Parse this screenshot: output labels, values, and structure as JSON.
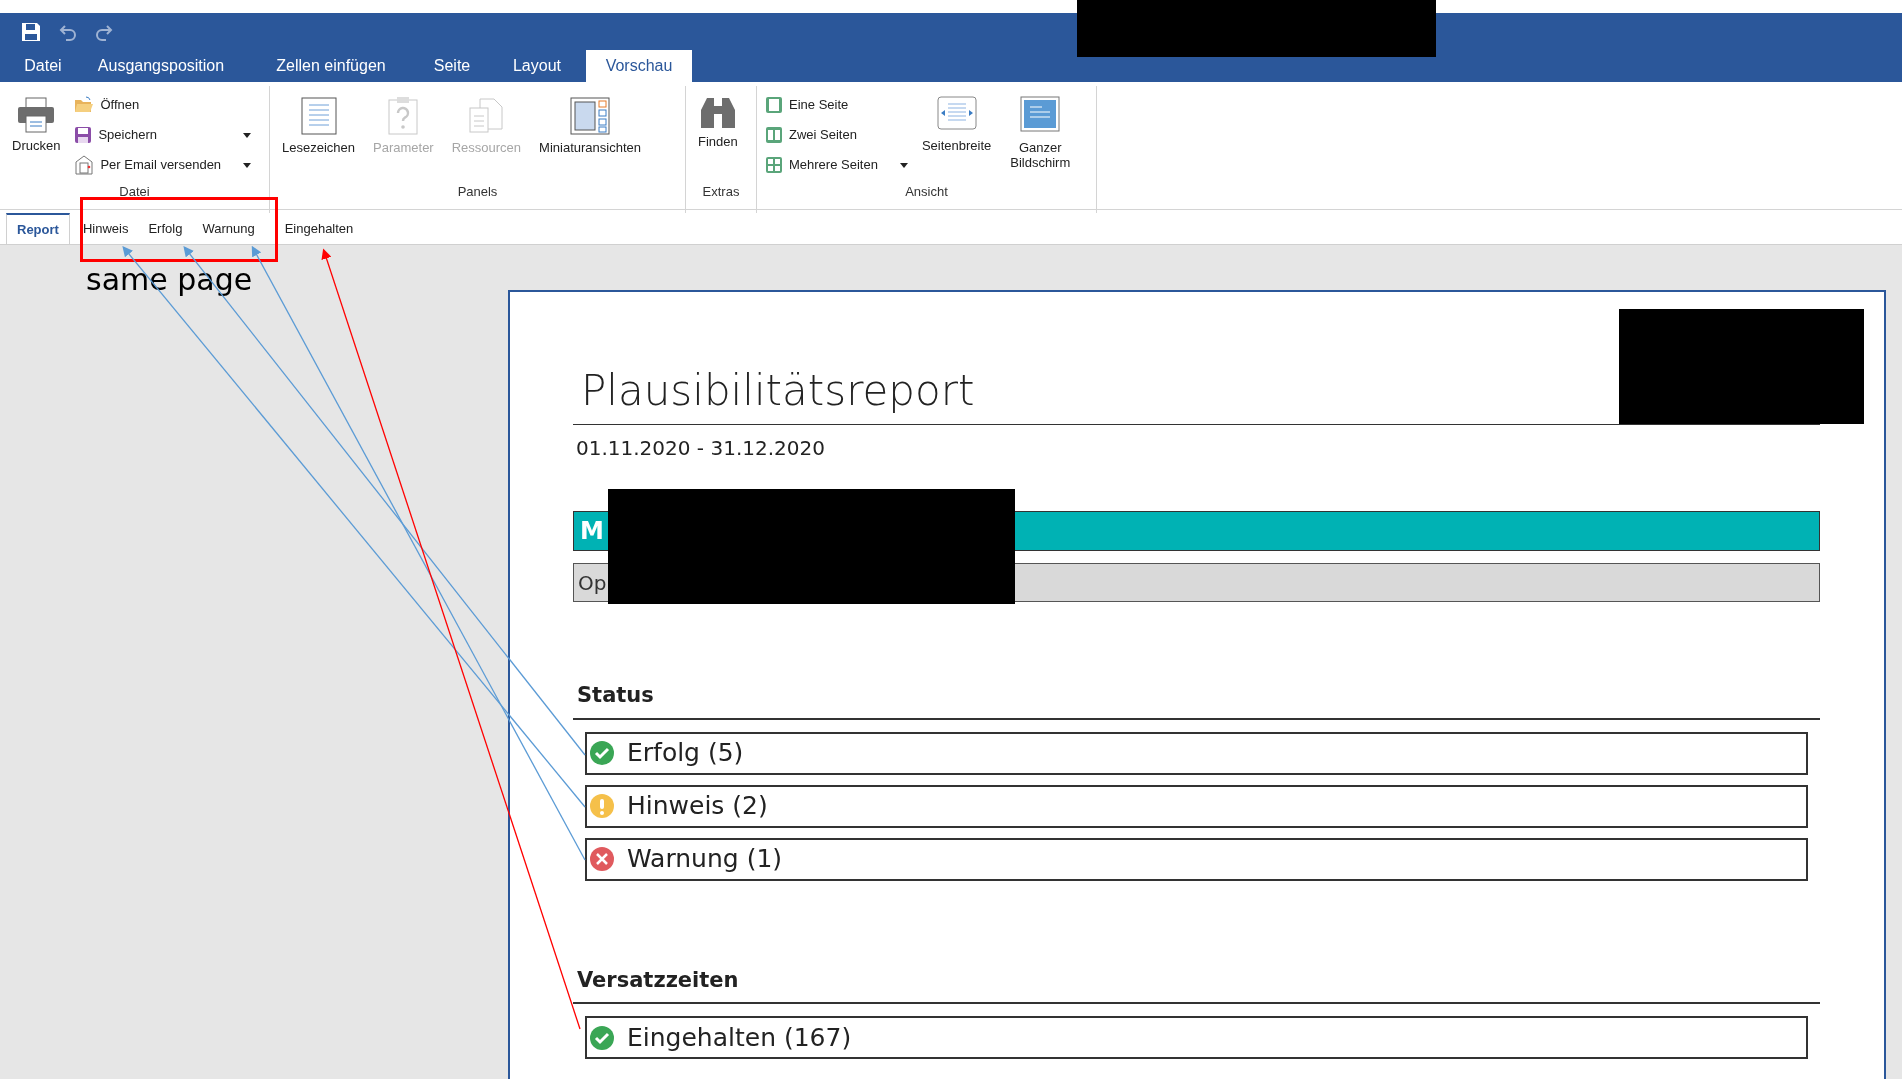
{
  "menu_tabs": [
    {
      "label": "Datei",
      "selected": false
    },
    {
      "label": "Ausgangsposition",
      "selected": false
    },
    {
      "label": "Zellen einfügen",
      "selected": false
    },
    {
      "label": "Seite",
      "selected": false
    },
    {
      "label": "Layout",
      "selected": false
    },
    {
      "label": "Vorschau",
      "selected": true
    }
  ],
  "ribbon_groups": [
    {
      "title": "Datei",
      "items": [
        {
          "kind": "large",
          "label": "Drucken",
          "disabled": false,
          "dropdown": false
        },
        {
          "kind": "small",
          "label": "Öffnen",
          "disabled": false,
          "dropdown": false
        },
        {
          "kind": "small",
          "label": "Speichern",
          "disabled": false,
          "dropdown": true
        },
        {
          "kind": "small",
          "label": "Per Email versenden",
          "disabled": false,
          "dropdown": true
        }
      ]
    },
    {
      "title": "Panels",
      "items": [
        {
          "kind": "large",
          "label": "Lesezeichen",
          "disabled": false,
          "dropdown": false
        },
        {
          "kind": "large",
          "label": "Parameter",
          "disabled": true,
          "dropdown": false
        },
        {
          "kind": "large",
          "label": "Ressourcen",
          "disabled": true,
          "dropdown": false
        },
        {
          "kind": "large",
          "label": "Miniaturansichten",
          "disabled": false,
          "dropdown": false
        }
      ]
    },
    {
      "title": "Extras",
      "items": [
        {
          "kind": "large",
          "label": "Finden",
          "disabled": false,
          "dropdown": false
        }
      ]
    },
    {
      "title": "Ansicht",
      "items": [
        {
          "kind": "small",
          "label": "Eine Seite",
          "disabled": false,
          "dropdown": false
        },
        {
          "kind": "small",
          "label": "Zwei Seiten",
          "disabled": false,
          "dropdown": false
        },
        {
          "kind": "small",
          "label": "Mehrere Seiten",
          "disabled": false,
          "dropdown": true
        },
        {
          "kind": "large",
          "label": "Seitenbreite",
          "disabled": false,
          "dropdown": false
        },
        {
          "kind": "large",
          "label": "Ganzer Bildschirm",
          "disabled": false,
          "dropdown": false
        }
      ]
    }
  ],
  "doc_tabs": [
    {
      "label": "Report",
      "selected": true
    },
    {
      "label": "Hinweis",
      "selected": false
    },
    {
      "label": "Erfolg",
      "selected": false
    },
    {
      "label": "Warnung",
      "selected": false
    },
    {
      "label": "Eingehalten",
      "selected": false
    }
  ],
  "report": {
    "title": "Plausibilitätsreport",
    "date_range": "01.11.2020 - 31.12.2020",
    "banner_text": "M",
    "subbanner_text": "Op",
    "sections": [
      {
        "heading": "Status",
        "rows": [
          {
            "kind": "success",
            "label": "Erfolg (5)"
          },
          {
            "kind": "info",
            "label": "Hinweis (2)"
          },
          {
            "kind": "error",
            "label": "Warnung (1)"
          }
        ]
      },
      {
        "heading": "Versatzzeiten",
        "rows": [
          {
            "kind": "success",
            "label": "Eingehalten (167)"
          }
        ]
      }
    ]
  },
  "annotation": {
    "note": "same page"
  }
}
